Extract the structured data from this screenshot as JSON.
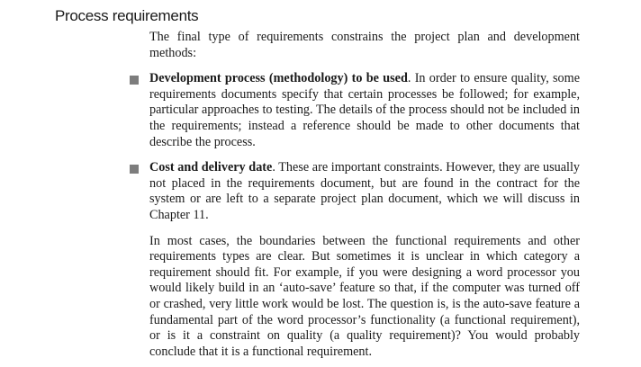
{
  "section": {
    "heading": "Process requirements",
    "intro": "The final type of requirements constrains the project plan and development methods:",
    "bullets": [
      {
        "term": "Development process (methodology) to be used",
        "text": ". In order to ensure quality, some requirements documents specify that certain processes be followed; for example, particular approaches to testing. The details of the process should not be included in the requirements; instead a reference should be made to other documents that describe the process."
      },
      {
        "term": "Cost and delivery date",
        "text": ". These are important constraints. However, they are usually not placed in the requirements document, but are found in the contract for the system or are left to a separate project plan document, which we will discuss in Chapter 11."
      }
    ],
    "closing": "In most cases, the boundaries between the functional requirements and other requirements types are clear. But sometimes it is unclear in which category a requirement should fit. For example, if you were designing a word processor you would likely build in an ‘auto-save’ feature so that, if the computer was turned off or crashed, very little work would be lost. The question is, is the auto-save feature a fundamental part of the word processor’s functionality (a functional requirement), or is it a constraint on quality (a quality requirement)? You would probably conclude that it is a functional requirement."
  },
  "colors": {
    "text": "#1a1a1a",
    "bullet_marker": "#7d7d7d",
    "background": "#ffffff"
  }
}
